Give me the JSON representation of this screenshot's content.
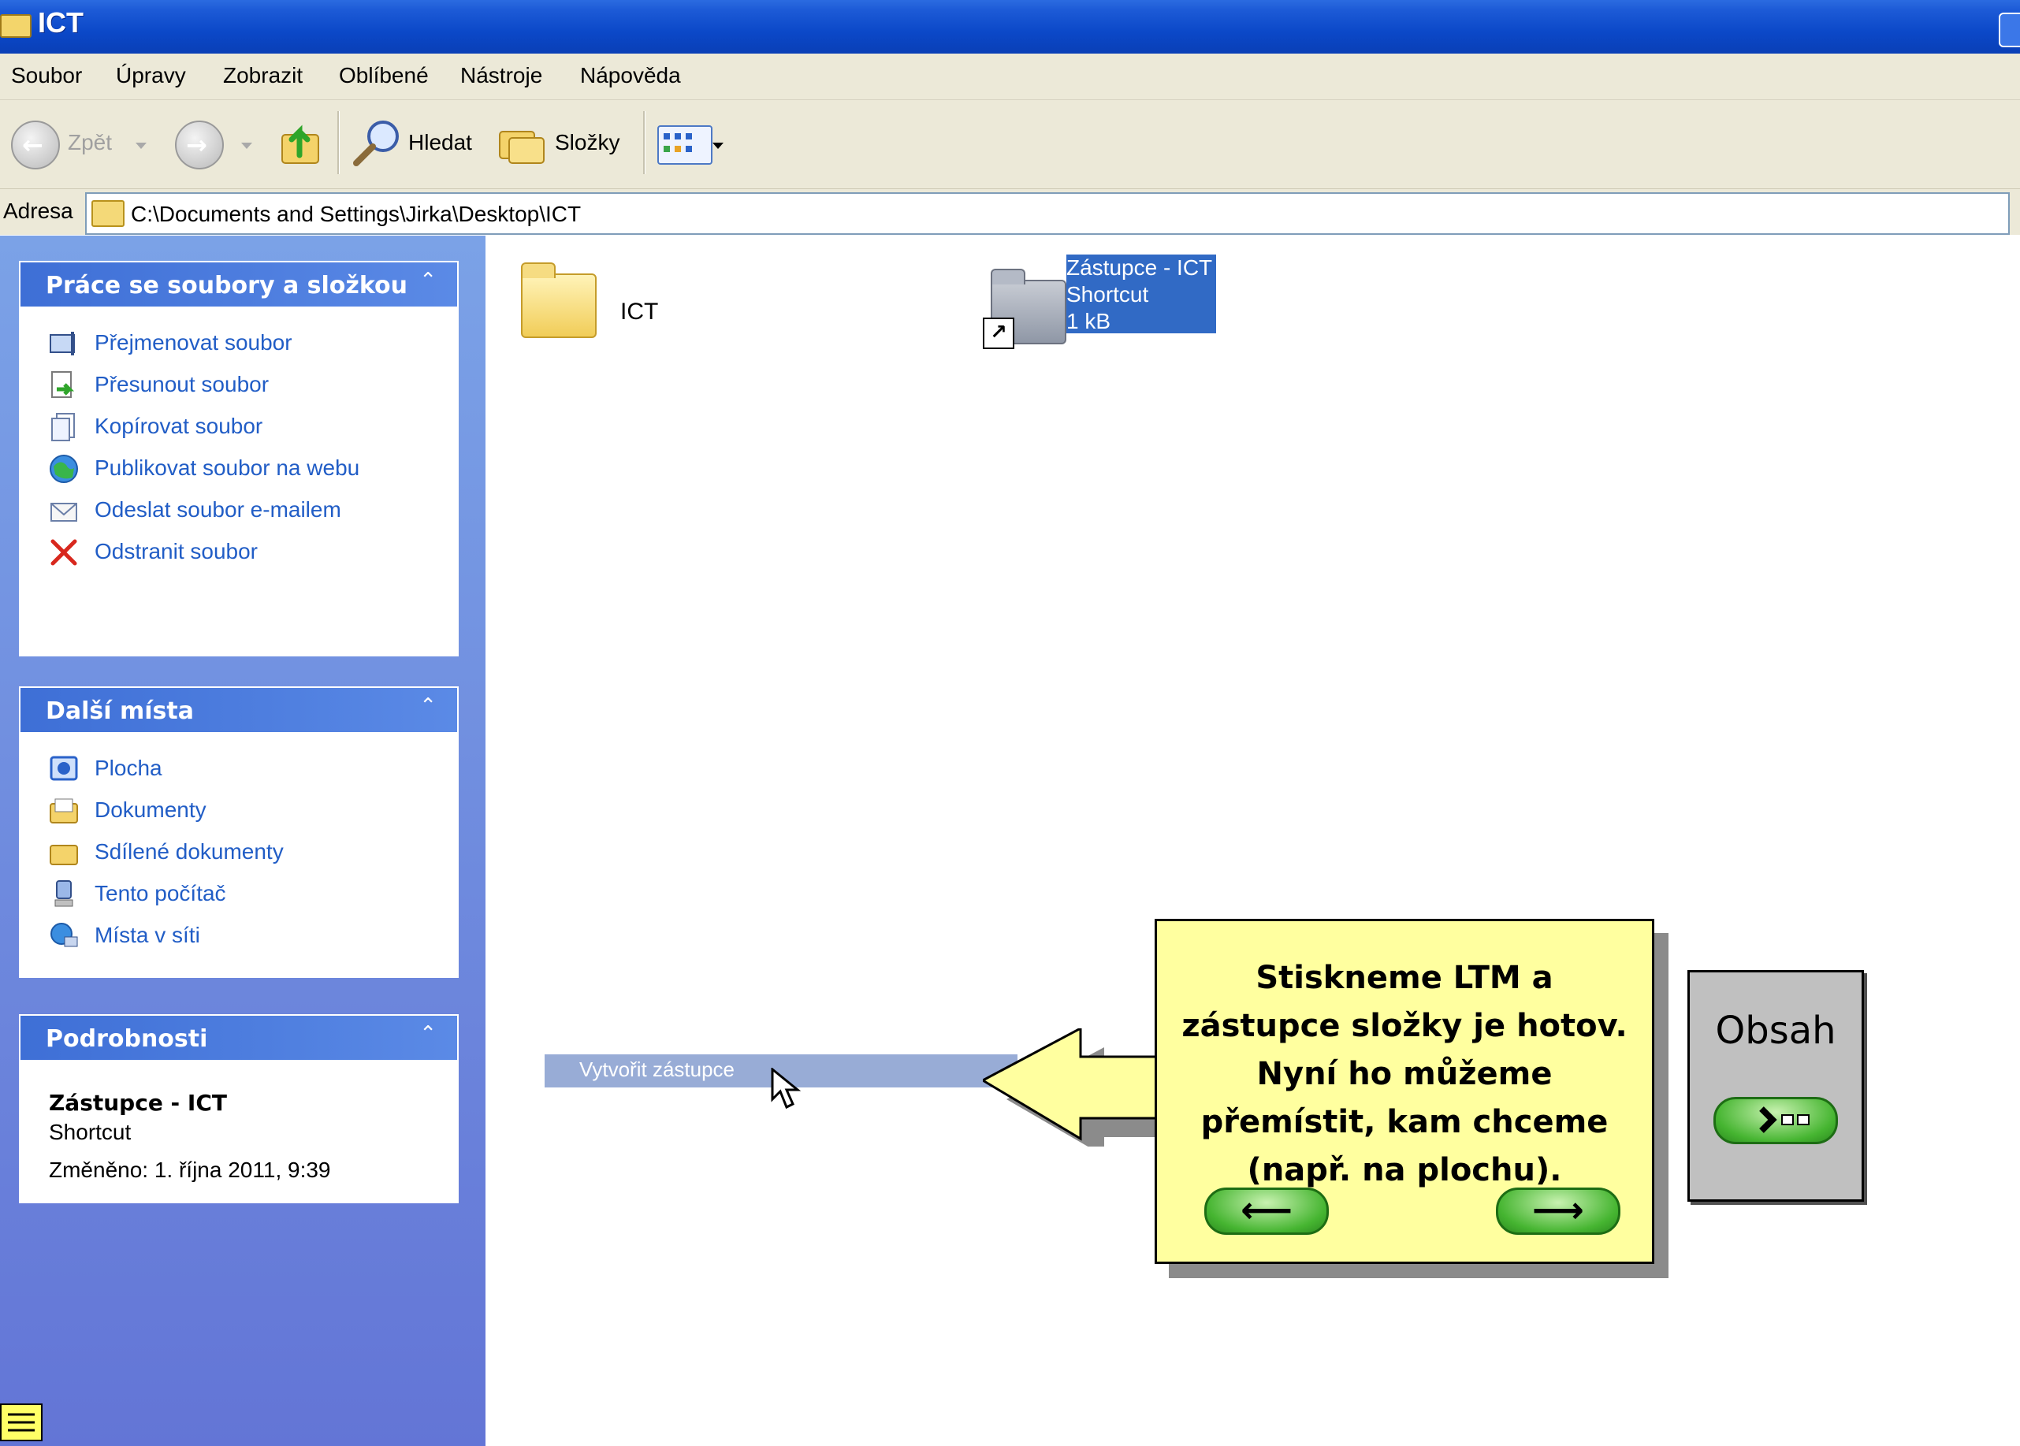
{
  "window": {
    "title": "ICT"
  },
  "menu": {
    "items": [
      "Soubor",
      "Úpravy",
      "Zobrazit",
      "Oblíbené",
      "Nástroje",
      "Nápověda"
    ]
  },
  "toolbar": {
    "back_label": "Zpět",
    "search_label": "Hledat",
    "folders_label": "Složky"
  },
  "address": {
    "label": "Adresa",
    "path": "C:\\Documents and Settings\\Jirka\\Desktop\\ICT"
  },
  "sidebar": {
    "file_tasks": {
      "title": "Práce se soubory a složkou",
      "items": [
        {
          "label": "Přejmenovat soubor",
          "icon": "rename-icon"
        },
        {
          "label": "Přesunout soubor",
          "icon": "move-icon"
        },
        {
          "label": "Kopírovat soubor",
          "icon": "copy-icon"
        },
        {
          "label": "Publikovat soubor na webu",
          "icon": "publish-web-icon"
        },
        {
          "label": "Odeslat soubor e-mailem",
          "icon": "email-icon"
        },
        {
          "label": "Odstranit soubor",
          "icon": "delete-icon"
        }
      ]
    },
    "other_places": {
      "title": "Další místa",
      "items": [
        {
          "label": "Plocha",
          "icon": "desktop-icon"
        },
        {
          "label": "Dokumenty",
          "icon": "documents-icon"
        },
        {
          "label": "Sdílené dokumenty",
          "icon": "shared-folder-icon"
        },
        {
          "label": "Tento počítač",
          "icon": "computer-icon"
        },
        {
          "label": "Místa v síti",
          "icon": "network-icon"
        }
      ]
    },
    "details": {
      "title": "Podrobnosti",
      "name": "Zástupce - ICT",
      "type": "Shortcut",
      "modified": "Změněno: 1. října 2011, 9:39"
    }
  },
  "files": [
    {
      "name": "ICT",
      "icon": "folder-icon"
    },
    {
      "name_line1": "Zástupce - ICT",
      "name_line2": "Shortcut",
      "size": "1 kB",
      "icon": "folder-shortcut-icon",
      "selected": true
    }
  ],
  "context_item": {
    "label": "Vytvořit zástupce"
  },
  "callout": {
    "text": "Stiskneme LTM a zástupce složky je hotov. Nyní ho můžeme přemístit, kam chceme (např. na plochu).",
    "prev_symbol": "⟵",
    "next_symbol": "⟶"
  },
  "obsah": {
    "label": "Obsah"
  },
  "colors": {
    "titlebar": "#0b48c8",
    "chrome": "#ece9d8",
    "sidebar": "#6e8fdf",
    "selection": "#316ac5",
    "callout_bg": "#ffff9f",
    "green_button": "#46b531"
  }
}
